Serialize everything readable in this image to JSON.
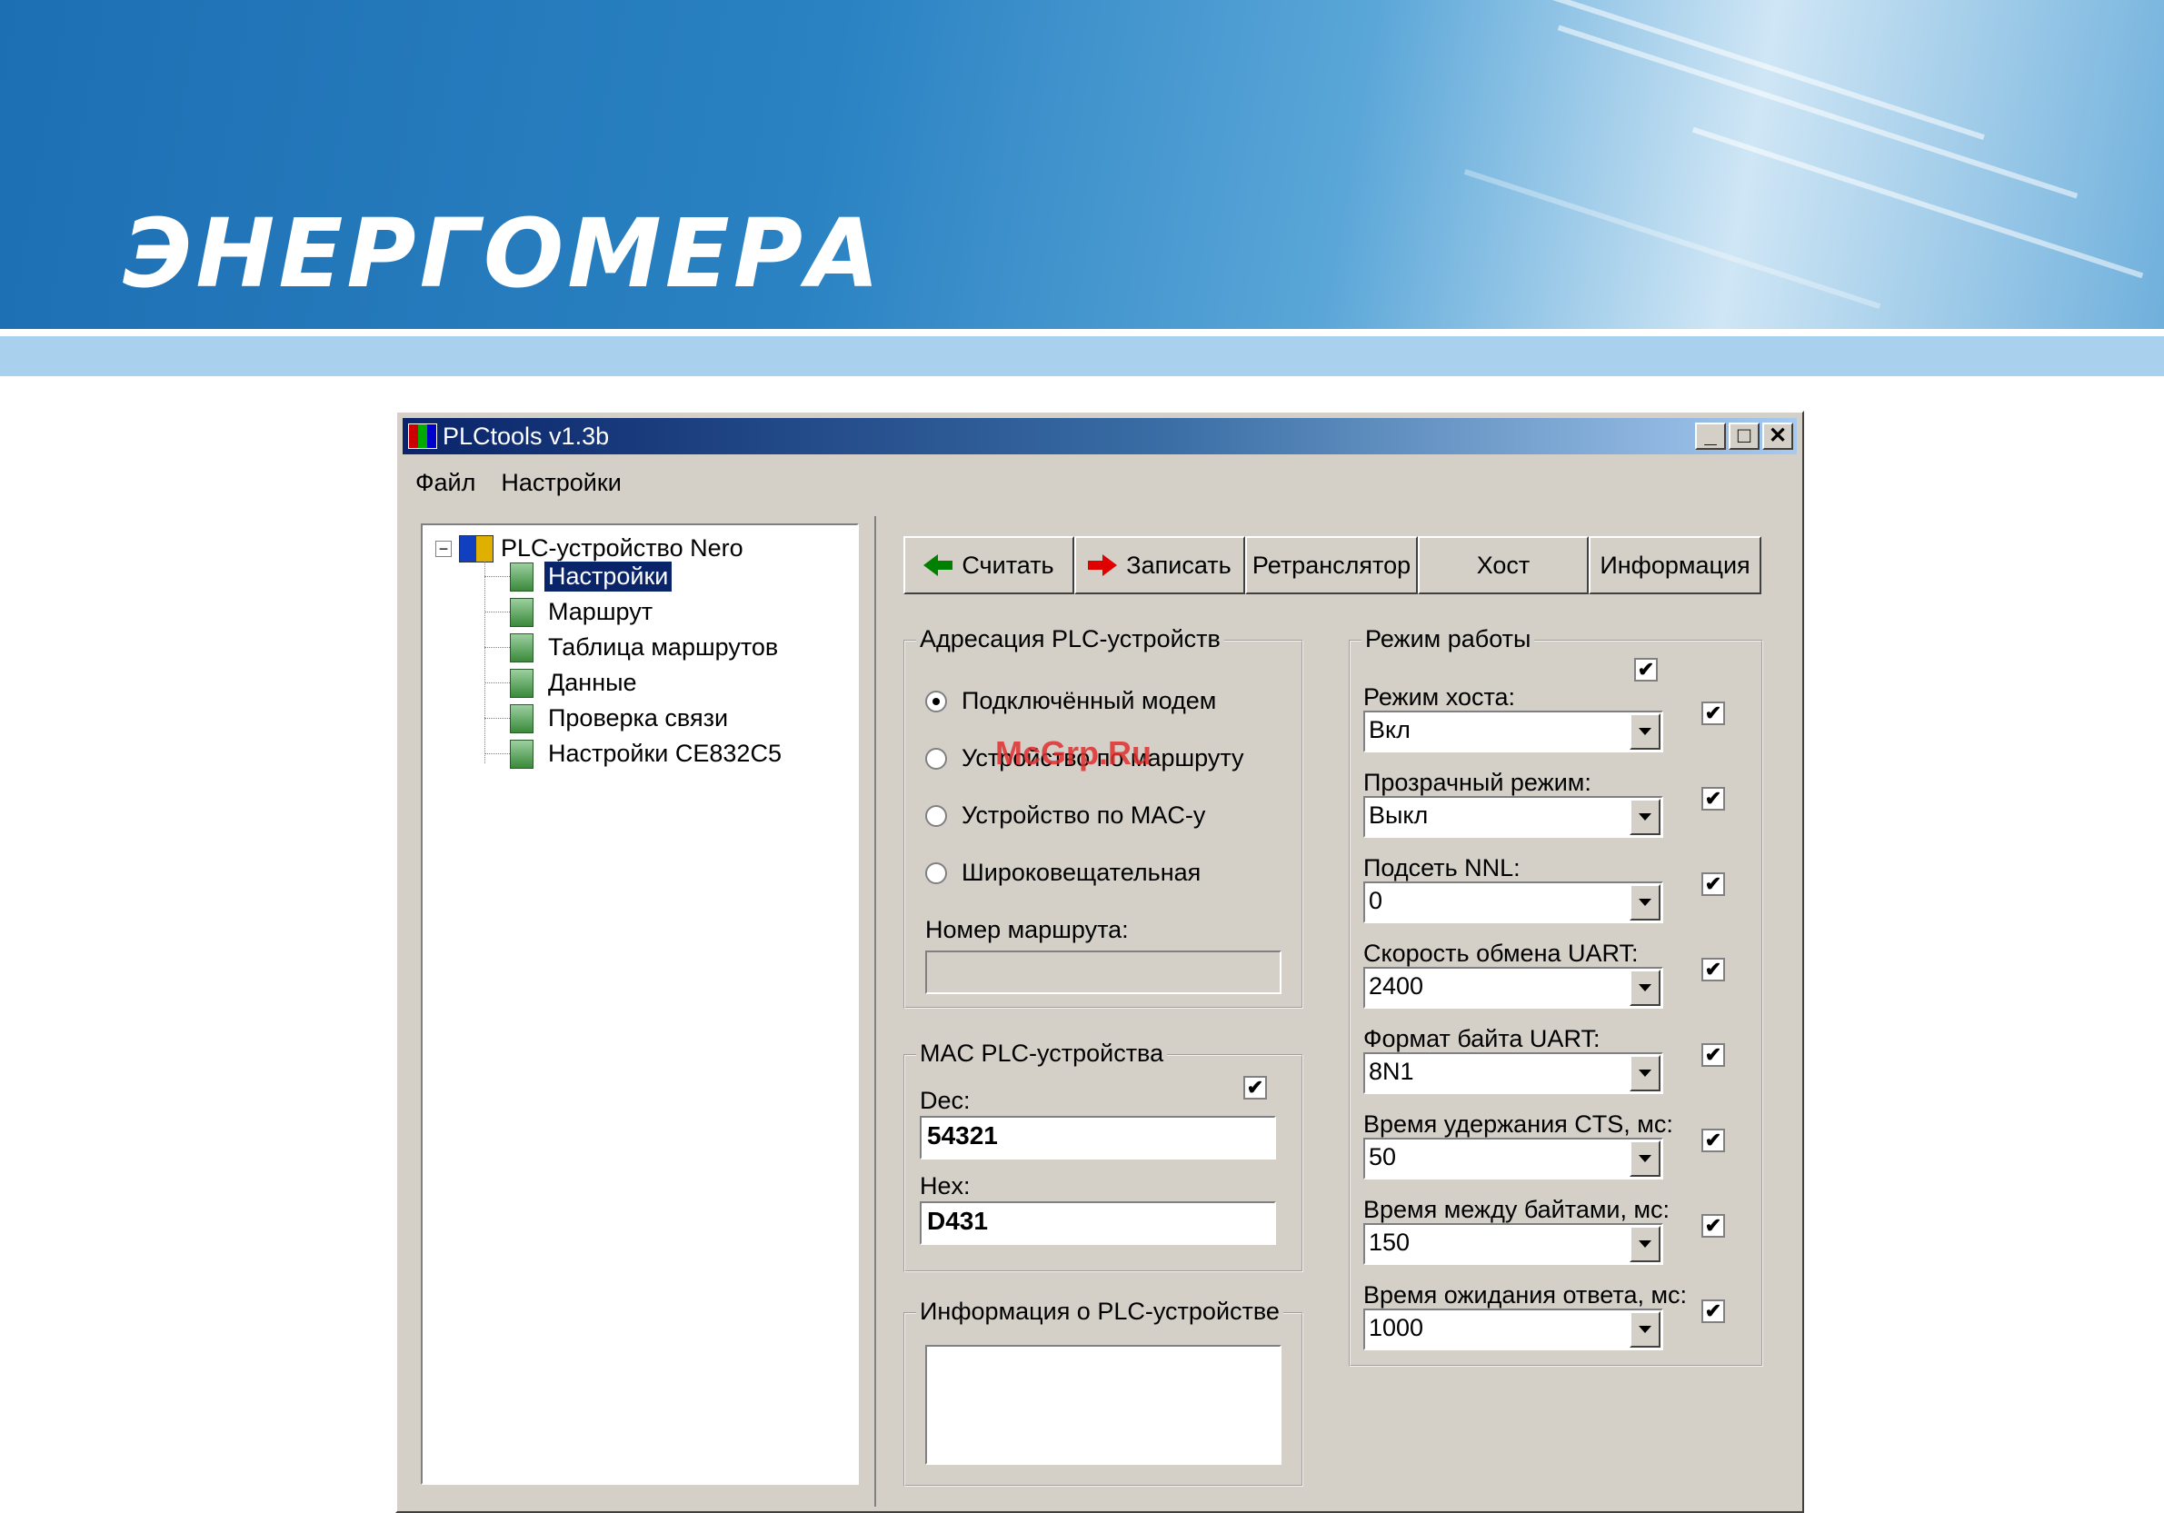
{
  "banner": {
    "logo": "ЭНЕРГОМЕРА"
  },
  "window": {
    "title": "PLCtools v1.3b",
    "controls": {
      "minimize": "_",
      "maximize": "□",
      "close": "✕"
    },
    "menu": [
      "Файл",
      "Настройки"
    ]
  },
  "tree": {
    "root": "PLC-устройство Nero",
    "expander": "−",
    "items": [
      "Настройки",
      "Маршрут",
      "Таблица маршрутов",
      "Данные",
      "Проверка связи",
      "Настройки CE832C5"
    ],
    "selected_index": 0
  },
  "toolbar": {
    "read": "Считать",
    "write": "Записать",
    "repeater": "Ретранслятор",
    "host": "Хост",
    "info": "Информация"
  },
  "addressing": {
    "title": "Адресация PLC-устройств",
    "options": [
      "Подключённый модем",
      "Устройство по маршруту",
      "Устройство по MAC-у",
      "Широковещательная"
    ],
    "selected": 0,
    "route_label": "Номер маршрута:",
    "route_value": ""
  },
  "mac": {
    "title": "MAC PLC-устройства",
    "checkbox": true,
    "dec_label": "Dec:",
    "dec_value": "54321",
    "hex_label": "Hex:",
    "hex_value": "D431"
  },
  "device_info": {
    "title": "Информация о PLC-устройстве",
    "value": ""
  },
  "mode": {
    "title": "Режим работы",
    "top_checkbox": true,
    "fields": [
      {
        "label": "Режим хоста:",
        "value": "Вкл",
        "checked": true
      },
      {
        "label": "Прозрачный режим:",
        "value": "Выкл",
        "checked": true
      },
      {
        "label": "Подсеть NNL:",
        "value": "0",
        "checked": true
      },
      {
        "label": "Скорость обмена UART:",
        "value": "2400",
        "checked": true
      },
      {
        "label": "Формат байта UART:",
        "value": "8N1",
        "checked": true
      },
      {
        "label": "Время удержания CTS, мс:",
        "value": "50",
        "checked": true
      },
      {
        "label": "Время между байтами, мс:",
        "value": "150",
        "checked": true
      },
      {
        "label": "Время ожидания ответа, мс:",
        "value": "1000",
        "checked": true
      }
    ]
  },
  "watermark": "McGrp.Ru",
  "check_glyph": "✔"
}
